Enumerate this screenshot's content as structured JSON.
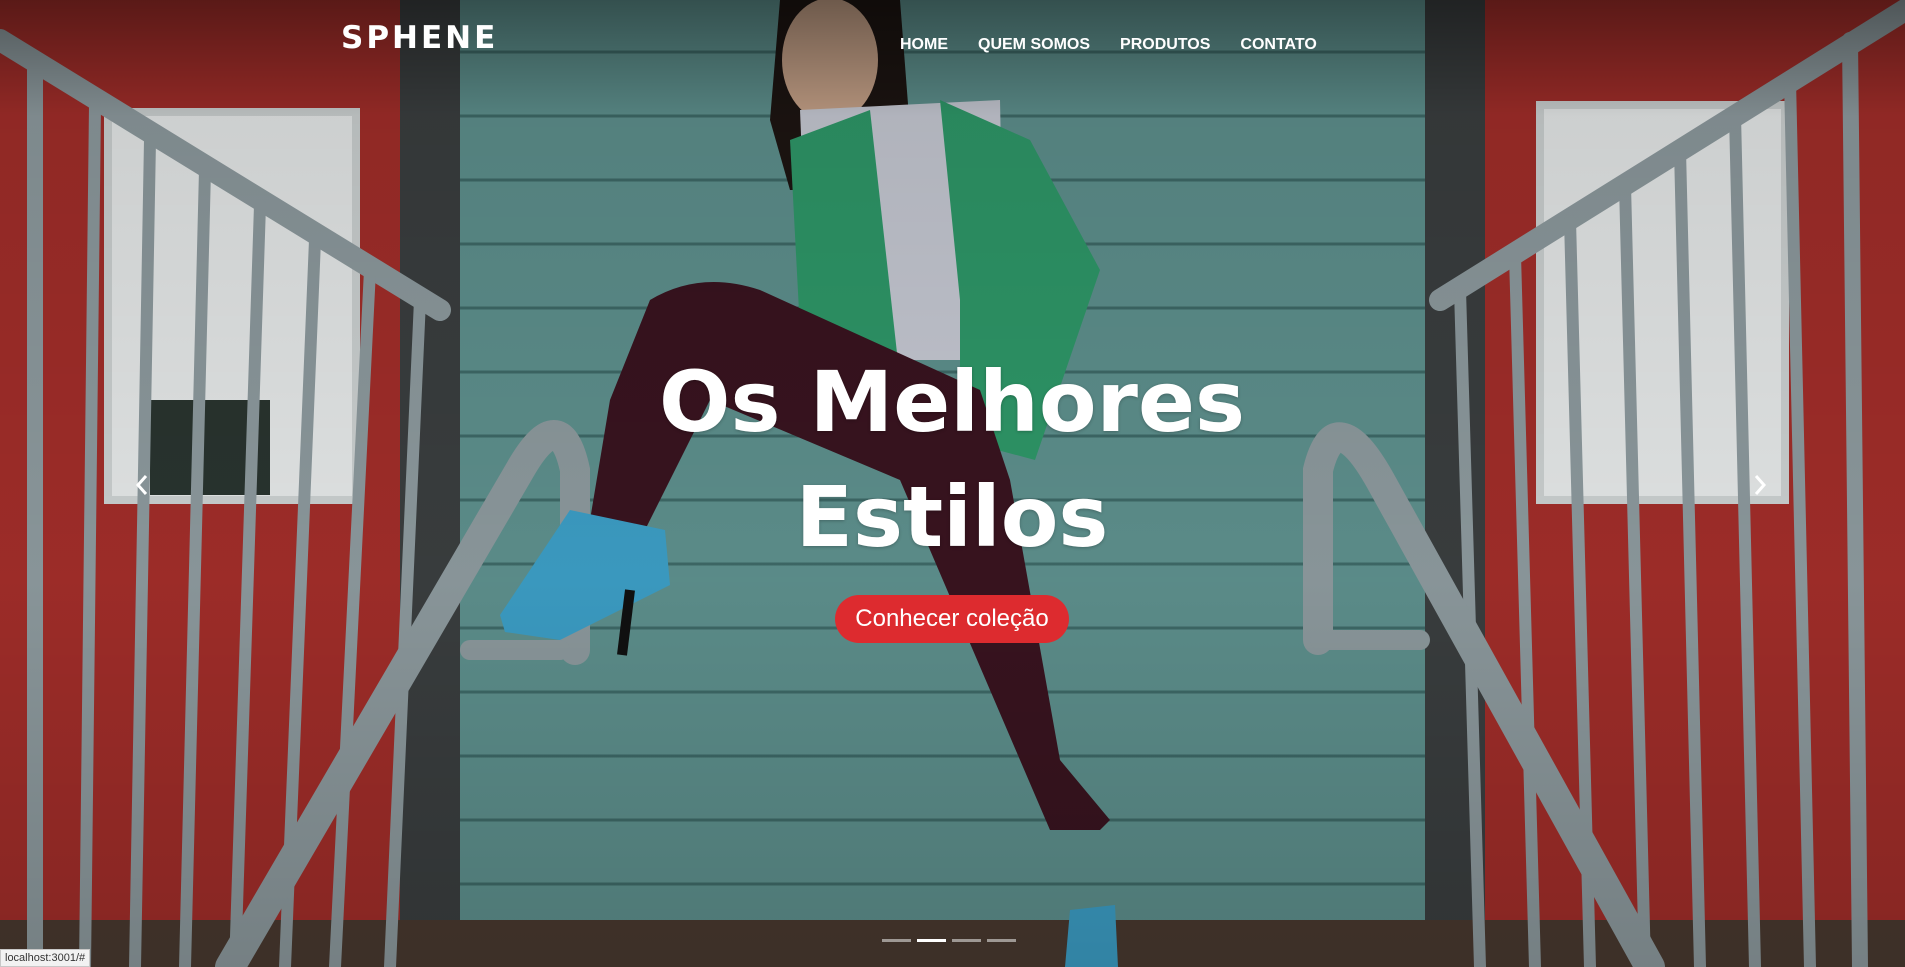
{
  "navbar": {
    "brand": "SPHENE",
    "links": [
      {
        "label": "HOME"
      },
      {
        "label": "QUEM SOMOS"
      },
      {
        "label": "PRODUTOS"
      },
      {
        "label": "CONTATO"
      }
    ]
  },
  "hero": {
    "title_line1": "Os Melhores",
    "title_line2": "Estilos",
    "cta_label": "Conhecer coleção"
  },
  "carousel": {
    "prev_icon": "chevron-left-icon",
    "next_icon": "chevron-right-icon",
    "slide_count": 4,
    "active_slide": 2
  },
  "statusbar": {
    "url": "localhost:3001/#"
  },
  "colors": {
    "cta": "#dd2b2f",
    "wall": "#5e8f8d",
    "door": "#a82f2b",
    "railing": "#8d9a9c"
  }
}
